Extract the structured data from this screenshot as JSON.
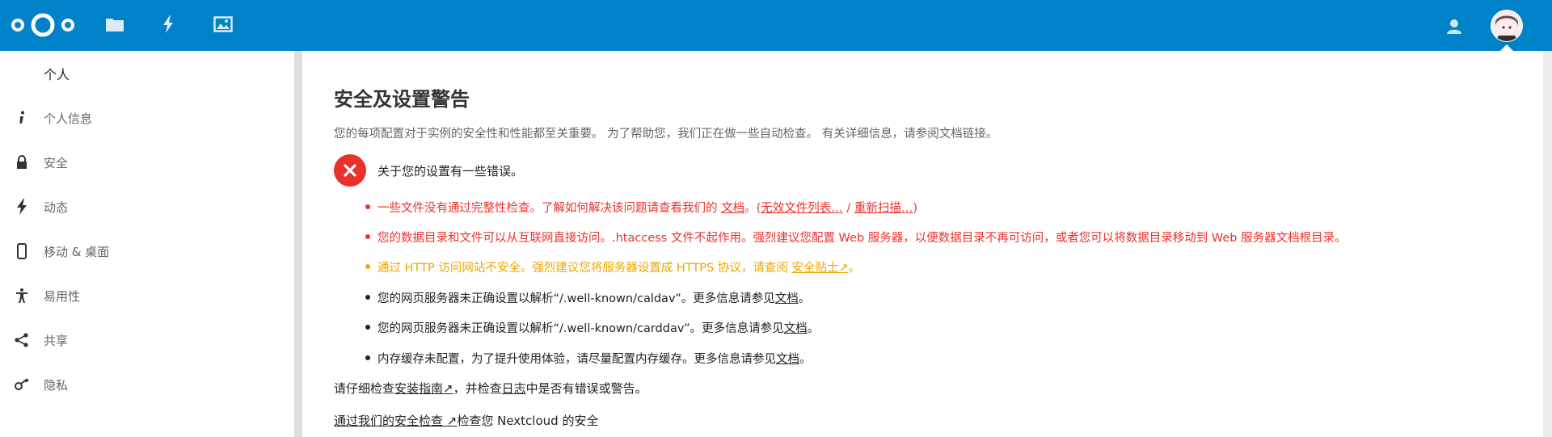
{
  "header": {
    "logo": "nextcloud-logo",
    "apps": [
      {
        "icon": "folder-icon"
      },
      {
        "icon": "lightning-icon"
      },
      {
        "icon": "image-icon"
      }
    ],
    "contacts_icon": "contacts-icon",
    "avatar_icon": "avatar"
  },
  "nav": {
    "heading": "个人",
    "items": [
      {
        "label": "个人信息",
        "icon": "info-icon"
      },
      {
        "label": "安全",
        "icon": "lock-icon"
      },
      {
        "label": "动态",
        "icon": "lightning-icon"
      },
      {
        "label": "移动 & 桌面",
        "icon": "phone-icon"
      },
      {
        "label": "易用性",
        "icon": "accessibility-icon"
      },
      {
        "label": "共享",
        "icon": "share-icon"
      },
      {
        "label": "隐私",
        "icon": "key-icon"
      }
    ]
  },
  "main": {
    "title": "安全及设置警告",
    "intro": "您的每项配置对于实例的安全性和性能都至关重要。 为了帮助您，我们正在做一些自动检查。 有关详细信息，请参阅文档链接。",
    "error_summary": "关于您的设置有一些错误。",
    "issues": {
      "i1": {
        "prefix": "一些文件没有通过完整性检查。了解如何解决该问题请查看我们的 ",
        "link_doc": "文档",
        "sep1": "。(",
        "link_list": "无效文件列表…",
        "sep2": " / ",
        "link_rescan": "重新扫描…",
        "suffix": ")"
      },
      "i2": {
        "text": "您的数据目录和文件可以从互联网直接访问。.htaccess 文件不起作用。强烈建议您配置 Web 服务器，以便数据目录不再可访问，或者您可以将数据目录移动到 Web 服务器文档根目录。"
      },
      "i3": {
        "prefix": "通过 HTTP 访问网站不安全。强烈建议您将服务器设置成 HTTPS 协议，请查阅 ",
        "link": "安全贴士↗",
        "suffix": "。"
      },
      "i4": {
        "prefix": "您的网页服务器未正确设置以解析“/.well-known/caldav”。更多信息请参见",
        "link": "文档",
        "suffix": "。"
      },
      "i5": {
        "prefix": "您的网页服务器未正确设置以解析“/.well-known/carddav”。更多信息请参见",
        "link": "文档",
        "suffix": "。"
      },
      "i6": {
        "prefix": "内存缓存未配置，为了提升使用体验，请尽量配置内存缓存。更多信息请参见",
        "link": "文档",
        "suffix": "。"
      }
    },
    "check_line": {
      "prefix": "请仔细检查",
      "link_guide": "安装指南↗",
      "mid": "，并检查",
      "link_log": "日志",
      "suffix": "中是否有错误或警告。"
    },
    "scan_line": {
      "link": "通过我们的安全检查 ↗",
      "suffix": "检查您 Nextcloud 的安全"
    }
  },
  "colors": {
    "header_bg": "#0082c9",
    "error": "#e9322d",
    "warning": "#eca700"
  }
}
